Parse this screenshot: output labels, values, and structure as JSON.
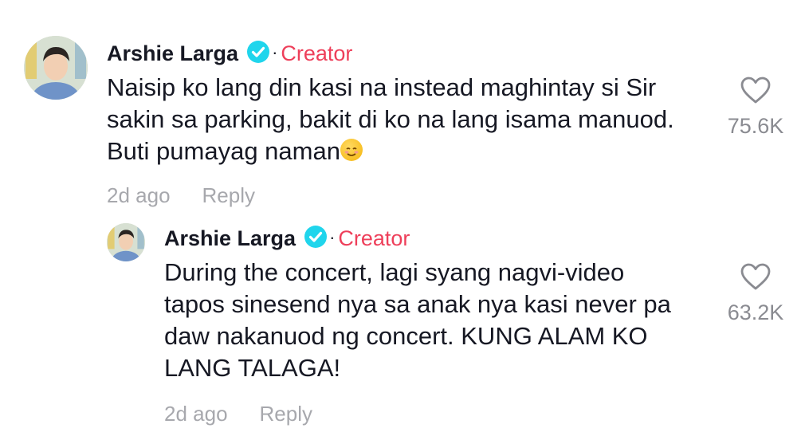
{
  "comments": [
    {
      "username": "Arshie Larga",
      "dot": "·",
      "badge": "Creator",
      "lines": [
        "Naisip ko lang din kasi na instead maghintay si Sir",
        "sakin sa parking, bakit di ko na lang isama manuod.",
        "Buti pumayag naman"
      ],
      "emoji": "☺️",
      "time": "2d ago",
      "reply_label": "Reply",
      "likes": "75.6K"
    },
    {
      "username": "Arshie Larga",
      "dot": "·",
      "badge": "Creator",
      "lines": [
        "During the concert, lagi syang nagvi-video",
        "tapos sinesend nya sa anak nya kasi never pa",
        "daw nakanuod ng concert. KUNG ALAM KO",
        "LANG TALAGA!"
      ],
      "time": "2d ago",
      "reply_label": "Reply",
      "likes": "63.2K"
    }
  ],
  "colors": {
    "badge": "#ee3f5a",
    "verified": "#20d5ec",
    "meta": "#a7a8ad"
  },
  "icons": [
    "verified-badge-icon",
    "heart-outline-icon",
    "avatar"
  ]
}
